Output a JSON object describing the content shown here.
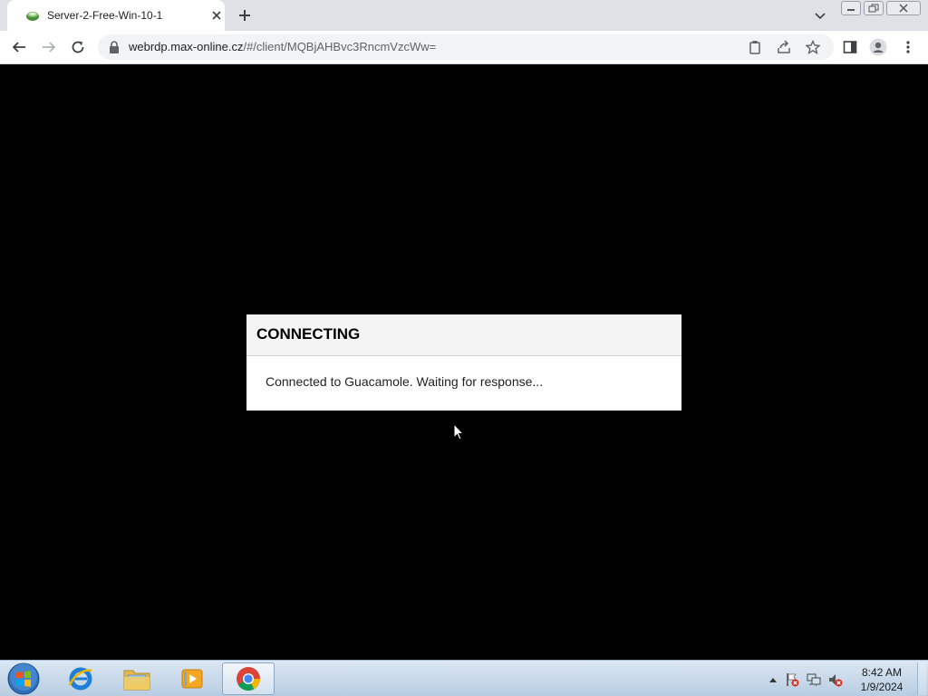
{
  "browser": {
    "tab": {
      "title": "Server-2-Free-Win-10-1"
    },
    "address": {
      "host": "webrdp.max-online.cz",
      "path": "/#/client/MQBjAHBvc3RncmVzcWw="
    }
  },
  "dialog": {
    "title": "CONNECTING",
    "message": "Connected to Guacamole. Waiting for response..."
  },
  "taskbar": {
    "apps": [
      "internet-explorer",
      "windows-explorer",
      "media-player",
      "google-chrome"
    ],
    "clock": {
      "time": "8:42 AM",
      "date": "1/9/2024"
    }
  },
  "colors": {
    "accent_green": "#4a8f3c",
    "tab_strip": "#dee1e6",
    "viewport": "#000000"
  }
}
